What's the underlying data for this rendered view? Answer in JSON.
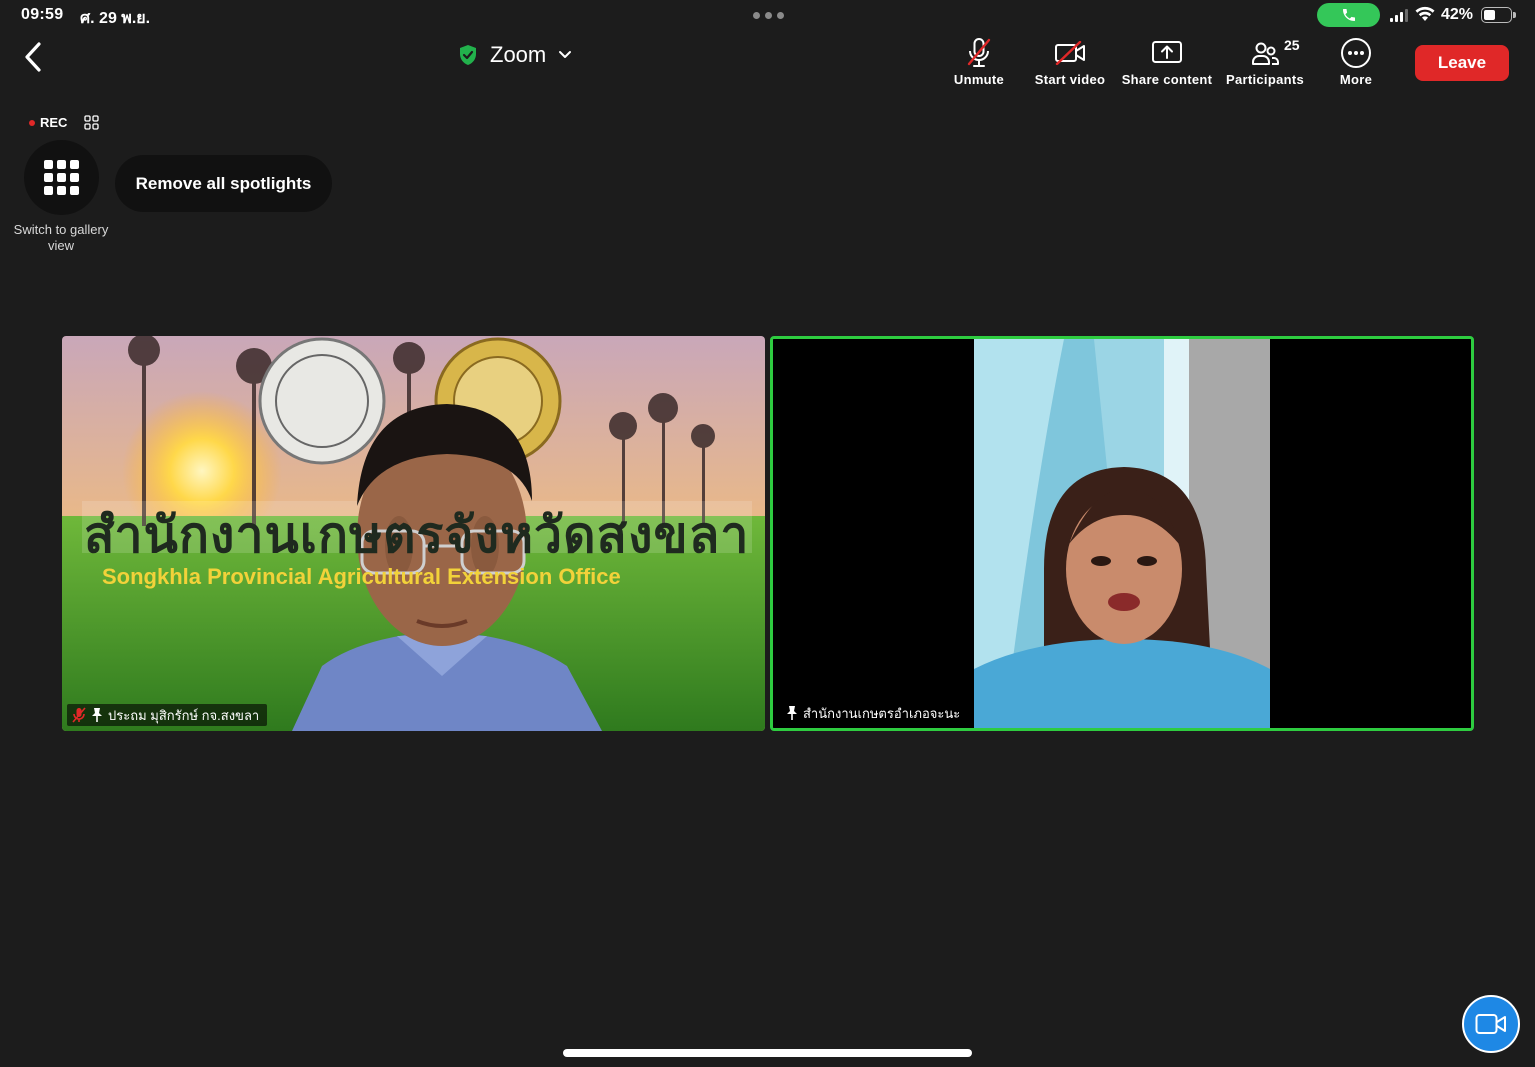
{
  "status_bar": {
    "time": "09:59",
    "date": "ศ. 29 พ.ย.",
    "battery": "42%",
    "battery_level": 0.42
  },
  "header": {
    "title": "Zoom",
    "leave_label": "Leave",
    "tools": {
      "unmute": "Unmute",
      "start_video": "Start video",
      "share_content": "Share content",
      "participants": "Participants",
      "participants_count": "25",
      "more": "More"
    }
  },
  "recording": {
    "label": "REC"
  },
  "view": {
    "gallery_label": "Switch to gallery view",
    "remove_spotlights": "Remove all spotlights"
  },
  "videos": [
    {
      "name": "ประถม มุสิกรักษ์ กจ.สงขลา",
      "banner_th": "สำนักงานเกษตรจังหวัดสงขลา",
      "banner_en": "Songkhla Provincial Agricultural Extension Office",
      "muted": true,
      "pinned": true,
      "active_speaker": false
    },
    {
      "name": "สำนักงานเกษตรอำเภอจะนะ",
      "muted": false,
      "pinned": true,
      "active_speaker": true
    }
  ],
  "colors": {
    "background": "#1c1c1c",
    "leave": "#e02828",
    "active_speaker": "#2ecc40",
    "call": "#34c759",
    "fab": "#1e88e5"
  }
}
